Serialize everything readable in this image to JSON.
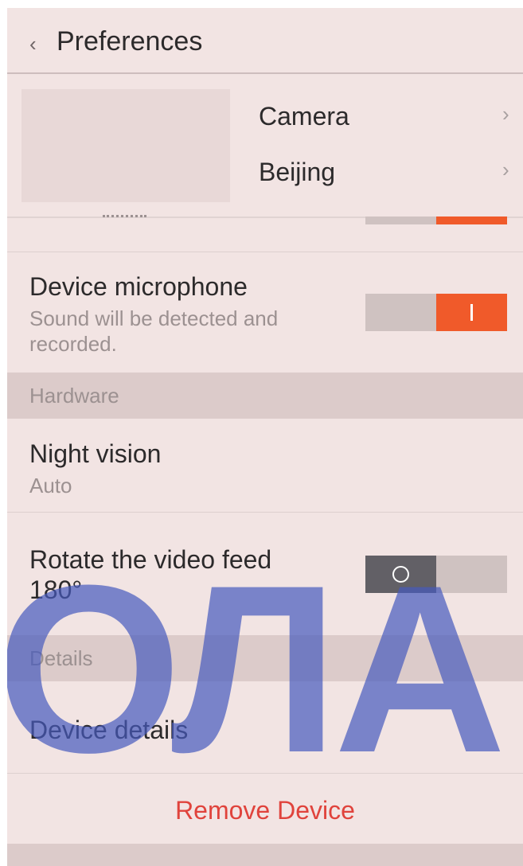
{
  "header": {
    "back_icon": "chevron-left-icon",
    "title": "Preferences"
  },
  "camera_card": {
    "name": "Camera",
    "location": "Beijing",
    "chevron_icon": "chevron-right-icon"
  },
  "peek_row": {
    "toggle_on": true
  },
  "settings": {
    "microphone": {
      "title": "Device microphone",
      "subtitle": "Sound will be detected and recorded.",
      "toggle_on": true
    }
  },
  "hardware": {
    "section_label": "Hardware",
    "night_vision": {
      "title": "Night vision",
      "value": "Auto"
    },
    "rotate": {
      "title_line1": "Rotate the video feed",
      "title_line2": "180°",
      "toggle_on": false
    }
  },
  "details": {
    "section_label": "Details",
    "device_details": "Device details"
  },
  "actions": {
    "remove_device": "Remove Device"
  },
  "colors": {
    "background": "#f2e4e3",
    "accent": "#f05a2a",
    "danger": "#e0433c",
    "toggle_off_knob": "#626066"
  },
  "watermark": {
    "text": "ОЛА"
  }
}
